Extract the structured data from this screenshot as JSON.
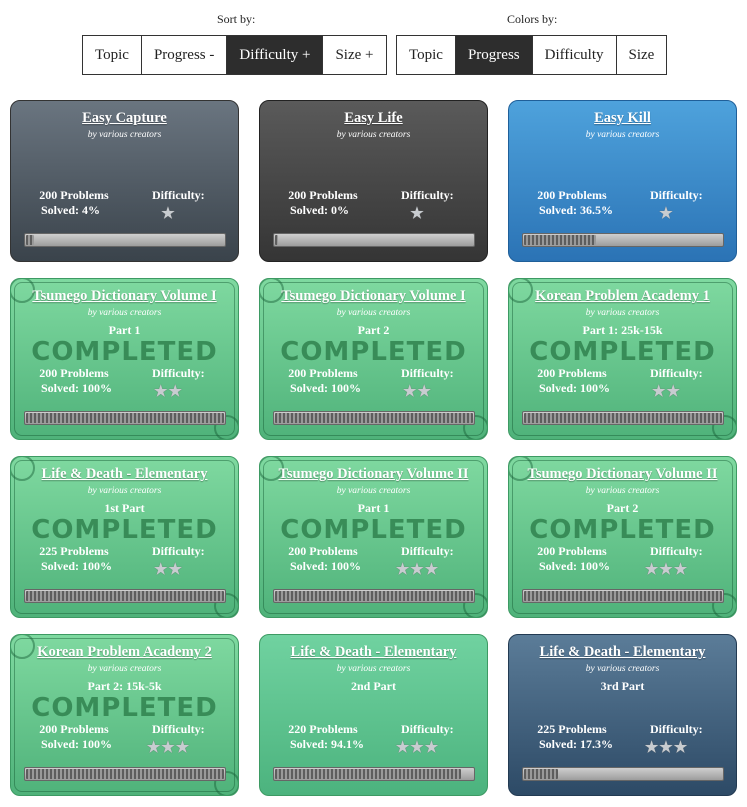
{
  "controls": {
    "sort_label": "Sort by:",
    "sort_buttons": [
      {
        "label": "Topic",
        "active": false
      },
      {
        "label": "Progress -",
        "active": false
      },
      {
        "label": "Difficulty +",
        "active": true
      },
      {
        "label": "Size +",
        "active": false
      }
    ],
    "colors_label": "Colors by:",
    "color_buttons": [
      {
        "label": "Topic",
        "active": false
      },
      {
        "label": "Progress",
        "active": true
      },
      {
        "label": "Difficulty",
        "active": false
      },
      {
        "label": "Size",
        "active": false
      }
    ]
  },
  "cards": [
    {
      "title": "Easy Capture",
      "byline": "by various creators",
      "part": "",
      "completed": false,
      "problems": "200 Problems",
      "solved": "Solved: 4%",
      "difficulty_label": "Difficulty:",
      "stars": 1,
      "progress": 0.04,
      "theme": "gray"
    },
    {
      "title": "Easy Life",
      "byline": "by various creators",
      "part": "",
      "completed": false,
      "problems": "200 Problems",
      "solved": "Solved: 0%",
      "difficulty_label": "Difficulty:",
      "stars": 1,
      "progress": 0.0,
      "theme": "dark"
    },
    {
      "title": "Easy Kill",
      "byline": "by various creators",
      "part": "",
      "completed": false,
      "problems": "200 Problems",
      "solved": "Solved: 36.5%",
      "difficulty_label": "Difficulty:",
      "stars": 1,
      "progress": 0.365,
      "theme": "blue"
    },
    {
      "title": "Tsumego Dictionary Volume I",
      "byline": "by various creators",
      "part": "Part 1",
      "completed": true,
      "stamp": "COMPLETED",
      "problems": "200 Problems",
      "solved": "Solved: 100%",
      "difficulty_label": "Difficulty:",
      "stars": 2,
      "progress": 1.0,
      "theme": "green"
    },
    {
      "title": "Tsumego Dictionary Volume I",
      "byline": "by various creators",
      "part": "Part 2",
      "completed": true,
      "stamp": "COMPLETED",
      "problems": "200 Problems",
      "solved": "Solved: 100%",
      "difficulty_label": "Difficulty:",
      "stars": 2,
      "progress": 1.0,
      "theme": "green"
    },
    {
      "title": "Korean Problem Academy 1",
      "byline": "by various creators",
      "part": "Part 1: 25k-15k",
      "completed": true,
      "stamp": "COMPLETED",
      "problems": "200 Problems",
      "solved": "Solved: 100%",
      "difficulty_label": "Difficulty:",
      "stars": 2,
      "progress": 1.0,
      "theme": "green"
    },
    {
      "title": "Life & Death - Elementary",
      "byline": "by various creators",
      "part": "1st Part",
      "completed": true,
      "stamp": "COMPLETED",
      "problems": "225 Problems",
      "solved": "Solved: 100%",
      "difficulty_label": "Difficulty:",
      "stars": 2,
      "progress": 1.0,
      "theme": "green"
    },
    {
      "title": "Tsumego Dictionary Volume II",
      "byline": "by various creators",
      "part": "Part 1",
      "completed": true,
      "stamp": "COMPLETED",
      "problems": "200 Problems",
      "solved": "Solved: 100%",
      "difficulty_label": "Difficulty:",
      "stars": 3,
      "progress": 1.0,
      "theme": "green"
    },
    {
      "title": "Tsumego Dictionary Volume II",
      "byline": "by various creators",
      "part": "Part 2",
      "completed": true,
      "stamp": "COMPLETED",
      "problems": "200 Problems",
      "solved": "Solved: 100%",
      "difficulty_label": "Difficulty:",
      "stars": 3,
      "progress": 1.0,
      "theme": "green"
    },
    {
      "title": "Korean Problem Academy 2",
      "byline": "by various creators",
      "part": "Part 2: 15k-5k",
      "completed": true,
      "stamp": "COMPLETED",
      "problems": "200 Problems",
      "solved": "Solved: 100%",
      "difficulty_label": "Difficulty:",
      "stars": 3,
      "progress": 1.0,
      "theme": "green"
    },
    {
      "title": "Life & Death - Elementary",
      "byline": "by various creators",
      "part": "2nd Part",
      "completed": false,
      "problems": "220 Problems",
      "solved": "Solved: 94.1%",
      "difficulty_label": "Difficulty:",
      "stars": 3,
      "progress": 0.941,
      "theme": "green-plain"
    },
    {
      "title": "Life & Death - Elementary",
      "byline": "by various creators",
      "part": "3rd Part",
      "completed": false,
      "problems": "225 Problems",
      "solved": "Solved: 17.3%",
      "difficulty_label": "Difficulty:",
      "stars": 3,
      "progress": 0.173,
      "theme": "slate"
    }
  ]
}
